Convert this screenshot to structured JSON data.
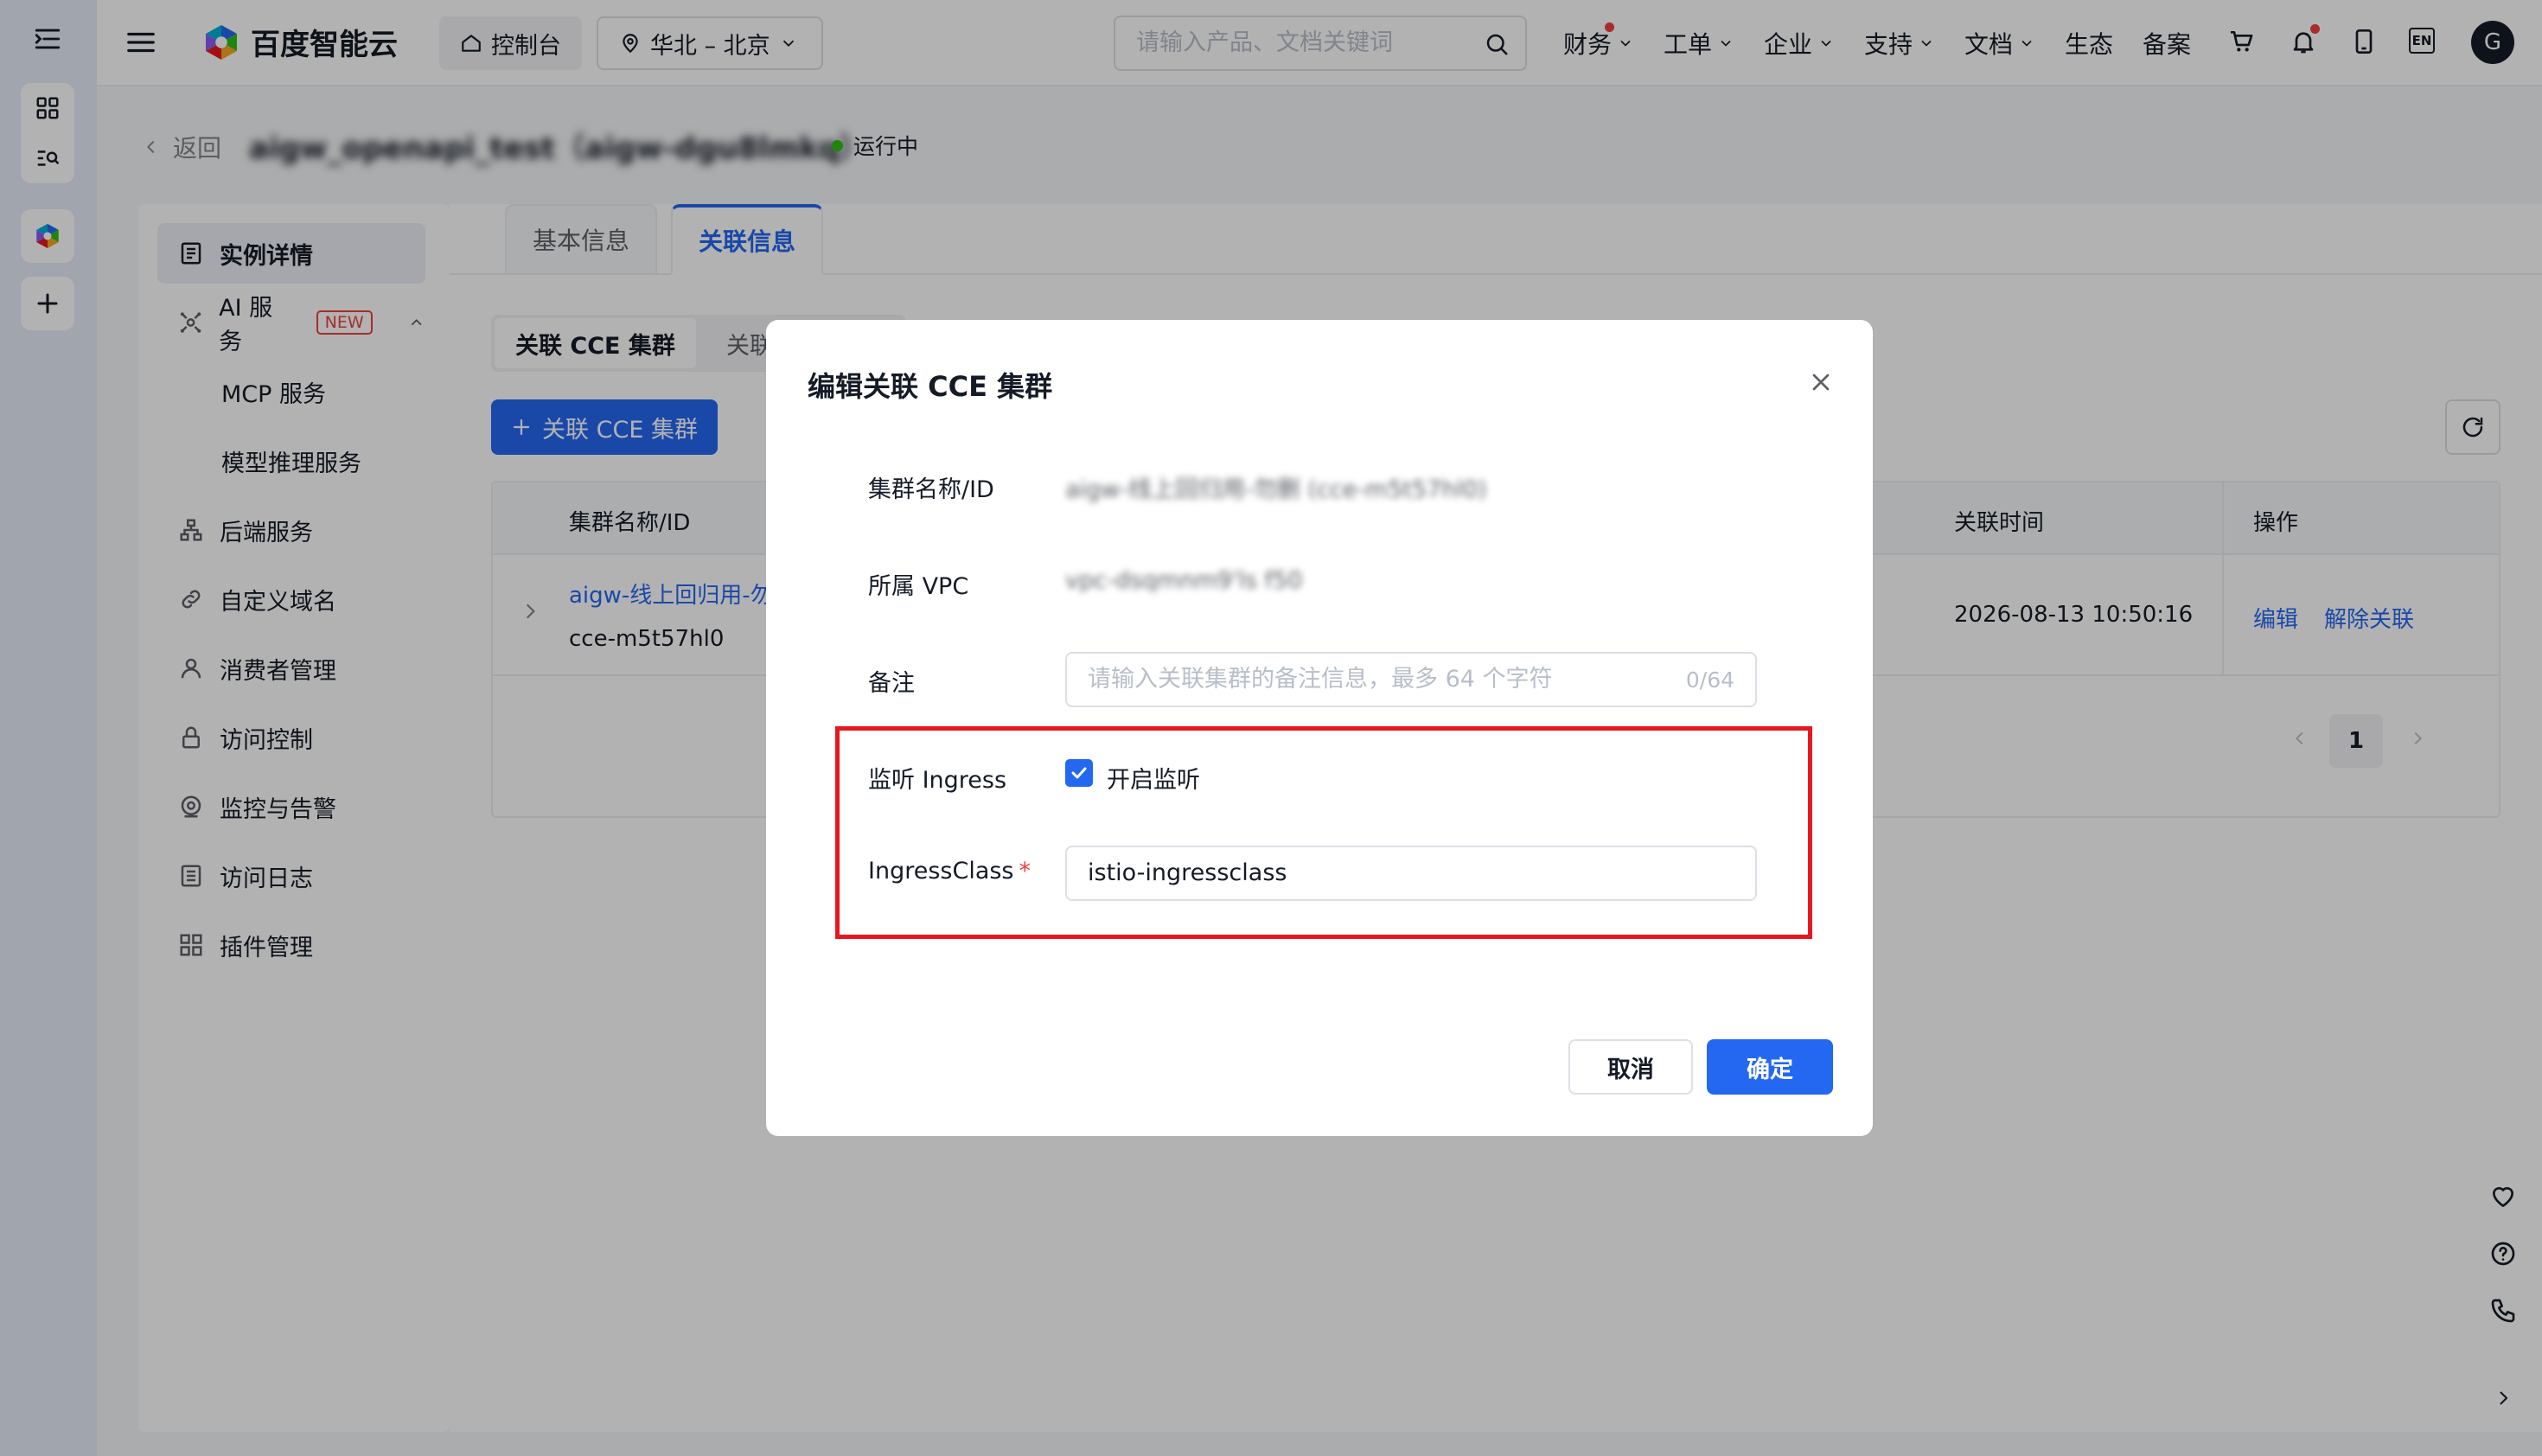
{
  "brand": {
    "logo_text": "百度智能云"
  },
  "topbar": {
    "console_label": "控制台",
    "region_label": "华北 – 北京",
    "search_placeholder": "请输入产品、文档关键词",
    "nav": [
      {
        "label": "财务",
        "has_dropdown": true,
        "has_dot": true
      },
      {
        "label": "工单",
        "has_dropdown": true
      },
      {
        "label": "企业",
        "has_dropdown": true
      },
      {
        "label": "支持",
        "has_dropdown": true
      },
      {
        "label": "文档",
        "has_dropdown": true
      },
      {
        "label": "生态"
      },
      {
        "label": "备案"
      }
    ],
    "lang_label": "EN",
    "avatar_letter": "G"
  },
  "header": {
    "back_label": "返回",
    "instance_title": "aigw_openapi_test（aigw-dgu8lmkq）",
    "status_label": "运行中",
    "status_color": "#30bf13"
  },
  "sidebar": {
    "items": [
      {
        "label": "实例详情",
        "icon": "document-icon",
        "active": true
      },
      {
        "label": "AI 服务",
        "icon": "ai-icon",
        "badge": "NEW",
        "expanded": true
      },
      {
        "label": "MCP 服务",
        "sub": true
      },
      {
        "label": "模型推理服务",
        "sub": true
      },
      {
        "label": "后端服务",
        "icon": "server-icon"
      },
      {
        "label": "自定义域名",
        "icon": "link-icon"
      },
      {
        "label": "消费者管理",
        "icon": "user-icon"
      },
      {
        "label": "访问控制",
        "icon": "lock-icon"
      },
      {
        "label": "监控与告警",
        "icon": "monitor-icon"
      },
      {
        "label": "访问日志",
        "icon": "log-icon"
      },
      {
        "label": "插件管理",
        "icon": "plugin-icon"
      }
    ]
  },
  "tabs": [
    {
      "label": "基本信息",
      "active": false
    },
    {
      "label": "关联信息",
      "active": true
    }
  ],
  "subtabs": [
    {
      "label": "关联 CCE 集群",
      "active": true
    },
    {
      "label": "关联",
      "active": false
    }
  ],
  "add_button_label": "关联 CCE 集群",
  "table": {
    "columns": [
      "集群名称/ID",
      "关联时间",
      "操作"
    ],
    "rows": [
      {
        "name": "aigw-线上回归用-勿",
        "id": "cce-m5t57hl0",
        "time": "2026-08-13 10:50:16",
        "actions": [
          "编辑",
          "解除关联"
        ]
      }
    ]
  },
  "pagination": {
    "current_page": "1"
  },
  "modal": {
    "title": "编辑关联 CCE 集群",
    "fields": {
      "cluster_label": "集群名称/ID",
      "cluster_value": "aigw-线上回归用-勿删 (cce-m5t57hl0)",
      "vpc_label": "所属 VPC",
      "vpc_value": "vpc-dsqmnm9'ls f50",
      "remark_label": "备注",
      "remark_placeholder": "请输入关联集群的备注信息，最多 64 个字符",
      "remark_counter": "0/64",
      "ingress_label": "监听 Ingress",
      "ingress_checkbox_label": "开启监听",
      "ingress_checked": true,
      "ingressclass_label": "IngressClass",
      "ingressclass_required": "*",
      "ingressclass_value": "istio-ingressclass"
    },
    "cancel_label": "取消",
    "confirm_label": "确定",
    "highlight_color": "#e8171f"
  },
  "colors": {
    "primary": "#2468f2",
    "rail_bg": "#e6ecfa",
    "danger": "#f33e3e"
  }
}
